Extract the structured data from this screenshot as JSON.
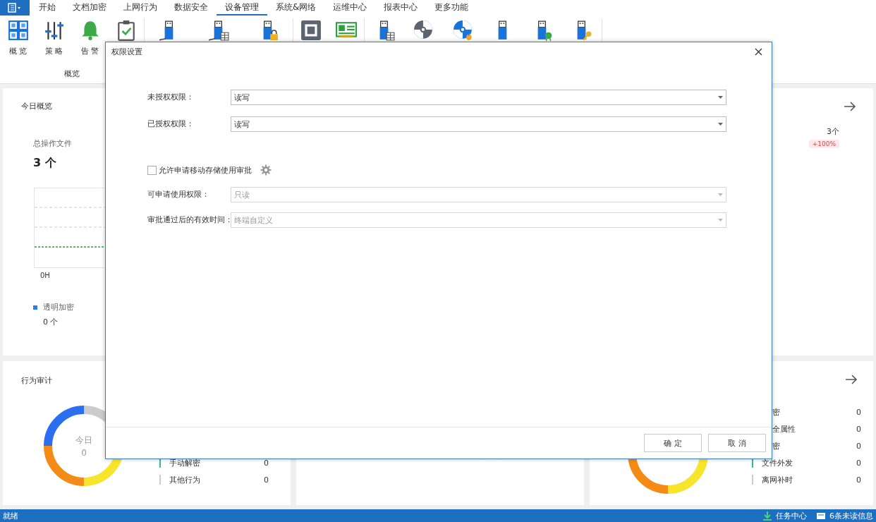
{
  "menu": {
    "tabs": [
      {
        "label": "开始",
        "selected": false
      },
      {
        "label": "文档加密",
        "selected": false
      },
      {
        "label": "上网行为",
        "selected": false
      },
      {
        "label": "数据安全",
        "selected": false
      },
      {
        "label": "设备管理",
        "selected": true
      },
      {
        "label": "系统&网络",
        "selected": false
      },
      {
        "label": "运维中心",
        "selected": false
      },
      {
        "label": "报表中心",
        "selected": false
      },
      {
        "label": "更多功能",
        "selected": false
      }
    ]
  },
  "ribbon": {
    "group_label": "概览",
    "tool_labels": [
      "概 览",
      "策 略",
      "告 警"
    ]
  },
  "overview": {
    "title": "今日概览",
    "total_label": "总操作文件",
    "total_value": "3 个",
    "chart_axis_label": "0H",
    "legend": [
      {
        "label": "透明加密",
        "value": "0 个",
        "color": "#2b7de9"
      }
    ],
    "right_value": "3个",
    "right_badge": "+100%"
  },
  "audit": {
    "title": "行为审计",
    "donut_center": [
      "今日",
      "0"
    ],
    "rows": [
      {
        "label": "手动解密",
        "value": "0",
        "color": "#3dbd8a"
      },
      {
        "label": "其他行为",
        "value": "0",
        "color": "#cccccc"
      }
    ]
  },
  "right_panel": {
    "rows_beside_dialog": [
      {
        "label": "密",
        "value": "0"
      },
      {
        "label": "全属性",
        "value": "0"
      },
      {
        "label": "密",
        "value": "0"
      }
    ],
    "rows": [
      {
        "label": "文件外发",
        "value": "0",
        "color": "#3dbd8a"
      },
      {
        "label": "离网补时",
        "value": "0",
        "color": "#cccccc"
      }
    ]
  },
  "dialog": {
    "title": "权限设置",
    "rows": [
      {
        "kind": "select",
        "label": "未授权权限：",
        "value": "读写",
        "disabled": false
      },
      {
        "kind": "select",
        "label": "已授权权限：",
        "value": "读写",
        "disabled": false
      },
      {
        "kind": "checkbox",
        "label": "允许申请移动存储使用审批",
        "checked": false
      },
      {
        "kind": "select",
        "label": "可申请使用权限：",
        "value": "只读",
        "disabled": true
      },
      {
        "kind": "select",
        "label": "审批通过后的有效时间：",
        "value": "终端自定义",
        "disabled": true
      }
    ],
    "buttons": [
      "确 定",
      "取 消"
    ]
  },
  "status_bar": {
    "left": "就绪",
    "task_center": "任务中心",
    "messages": "6条未读信息"
  }
}
